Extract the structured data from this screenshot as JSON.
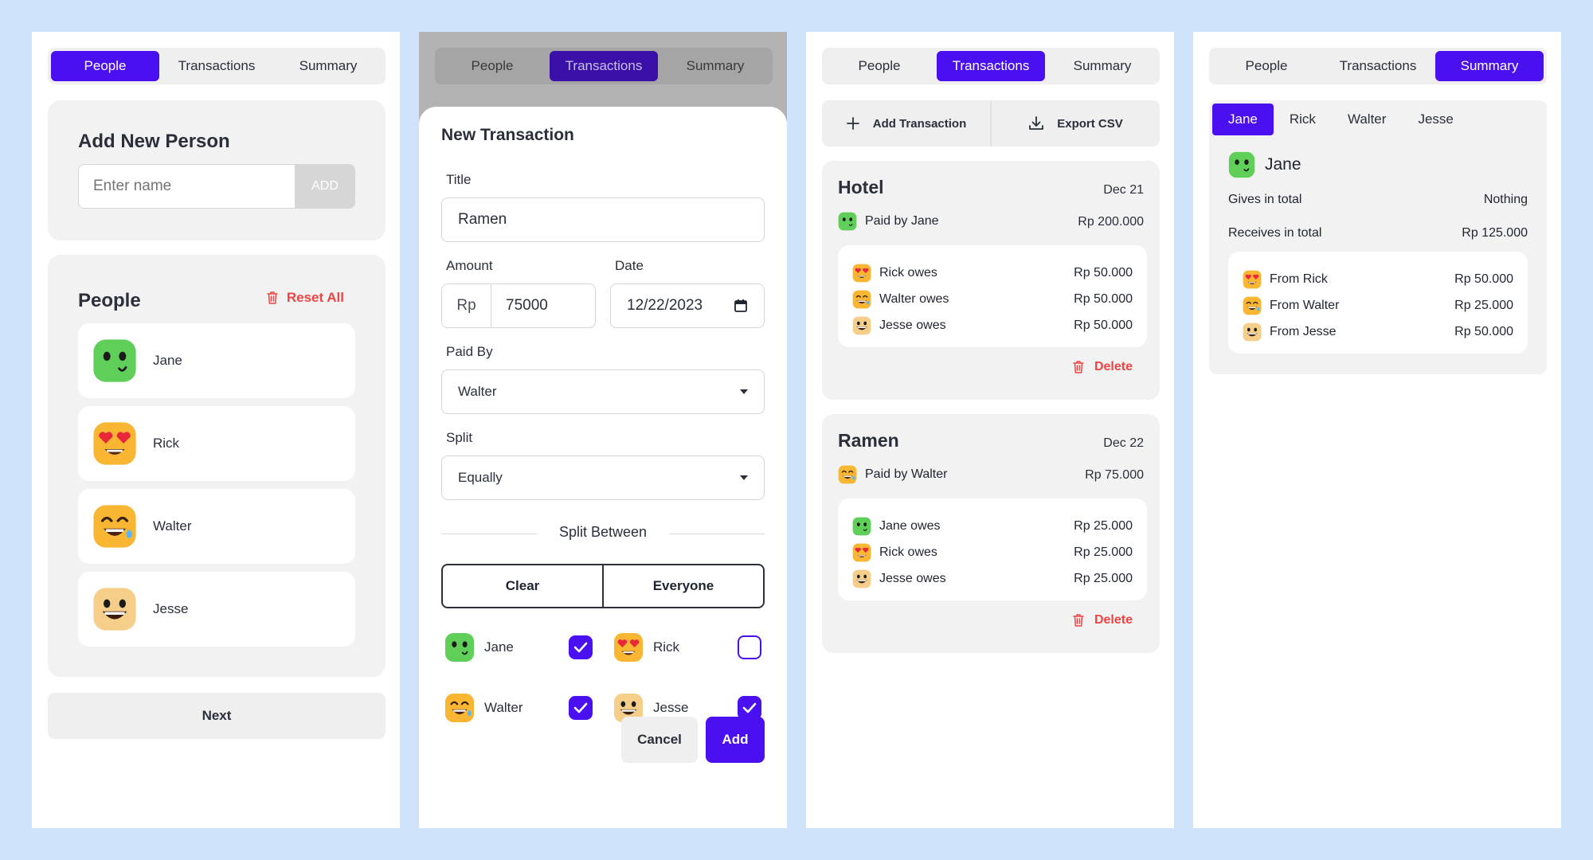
{
  "tabs": [
    "People",
    "Transactions",
    "Summary"
  ],
  "add_person": {
    "title": "Add New Person",
    "placeholder": "Enter name",
    "add_label": "ADD"
  },
  "people_list": {
    "title": "People",
    "reset_label": "Reset All",
    "people": [
      "Jane",
      "Rick",
      "Walter",
      "Jesse"
    ],
    "next_label": "Next"
  },
  "new_transaction": {
    "title": "New Transaction",
    "title_label": "Title",
    "title_value": "Ramen",
    "amount_label": "Amount",
    "currency": "Rp",
    "amount_value": "75000",
    "date_label": "Date",
    "date_value": "12/22/2023",
    "paid_by_label": "Paid By",
    "paid_by_value": "Walter",
    "split_label": "Split",
    "split_value": "Equally",
    "split_between_label": "Split Between",
    "clear_label": "Clear",
    "everyone_label": "Everyone",
    "participants": [
      {
        "name": "Jane",
        "checked": true
      },
      {
        "name": "Rick",
        "checked": false
      },
      {
        "name": "Walter",
        "checked": true
      },
      {
        "name": "Jesse",
        "checked": true
      }
    ],
    "cancel_label": "Cancel",
    "add_label": "Add"
  },
  "transactions": {
    "add_label": "Add Transaction",
    "export_label": "Export CSV",
    "delete_label": "Delete",
    "items": [
      {
        "title": "Hotel",
        "date": "Dec 21",
        "paid_by": "Paid by Jane",
        "total": "Rp 200.000",
        "owes": [
          {
            "label": "Rick owes",
            "amount": "Rp 50.000"
          },
          {
            "label": "Walter owes",
            "amount": "Rp 50.000"
          },
          {
            "label": "Jesse owes",
            "amount": "Rp 50.000"
          }
        ]
      },
      {
        "title": "Ramen",
        "date": "Dec 22",
        "paid_by": "Paid by Walter",
        "total": "Rp 75.000",
        "owes": [
          {
            "label": "Jane owes",
            "amount": "Rp 25.000"
          },
          {
            "label": "Rick owes",
            "amount": "Rp 25.000"
          },
          {
            "label": "Jesse owes",
            "amount": "Rp 25.000"
          }
        ]
      }
    ]
  },
  "summary": {
    "people": [
      "Jane",
      "Rick",
      "Walter",
      "Jesse"
    ],
    "selected": "Jane",
    "gives_label": "Gives in total",
    "gives_value": "Nothing",
    "receives_label": "Receives in total",
    "receives_value": "Rp 125.000",
    "from": [
      {
        "label": "From Rick",
        "amount": "Rp 50.000"
      },
      {
        "label": "From Walter",
        "amount": "Rp 25.000"
      },
      {
        "label": "From Jesse",
        "amount": "Rp 50.000"
      }
    ]
  },
  "colors": {
    "accent": "#4b10f0",
    "danger": "#ef4444",
    "background": "#cfe3fb"
  }
}
